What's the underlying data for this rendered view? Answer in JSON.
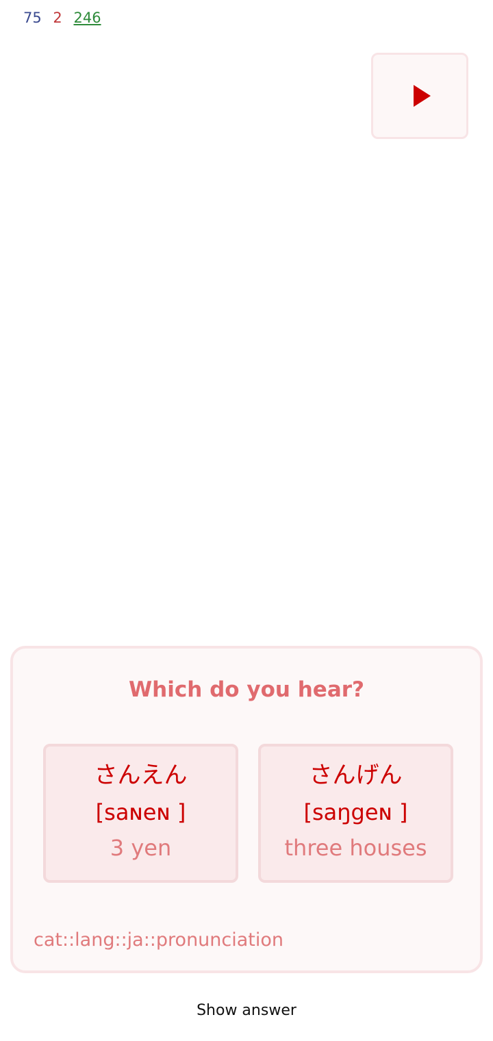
{
  "counts": {
    "new": "75",
    "learning": "2",
    "review": "246"
  },
  "play_icon": "play-icon",
  "card": {
    "question": "Which do you hear?",
    "options": [
      {
        "kana": "さんえん",
        "ipa": "[saɴeɴ ]",
        "meaning": "3 yen"
      },
      {
        "kana": "さんげん",
        "ipa": "[saŋgeɴ ]",
        "meaning": "three houses"
      }
    ],
    "tags": "cat::lang::ja::pronunciation"
  },
  "footer": {
    "show_answer": "Show answer"
  },
  "colors": {
    "accent": "#cc0000",
    "muted_accent": "#e07a7c",
    "card_border": "#f8e4e6",
    "new_count": "#3a4a8f",
    "learning_count": "#c0383a",
    "review_count": "#2e8b3a"
  }
}
